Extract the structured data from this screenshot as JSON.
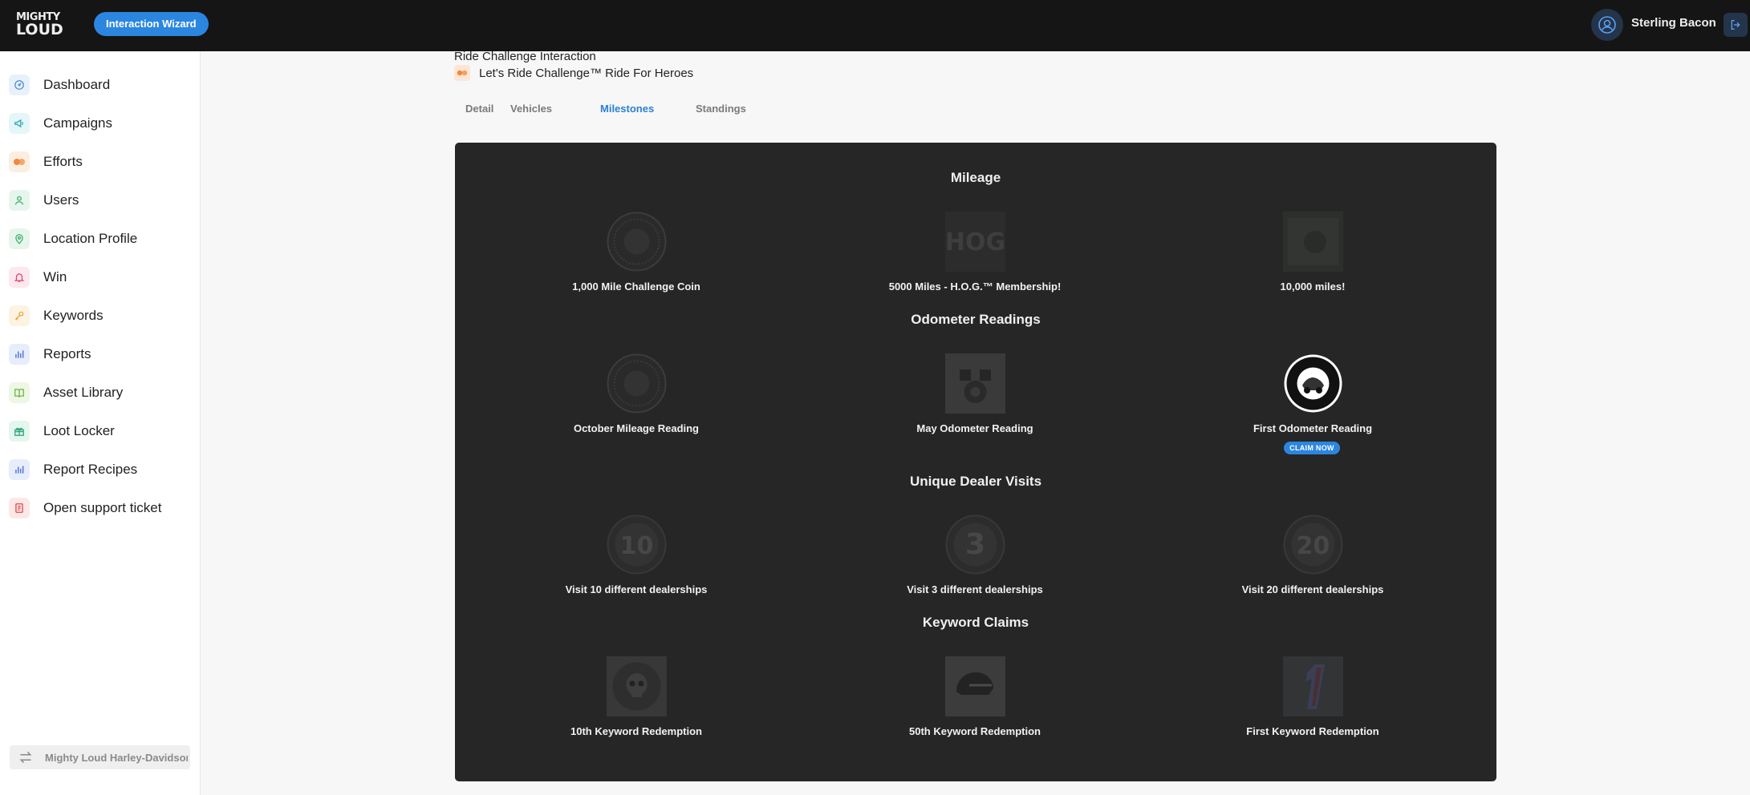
{
  "topbar": {
    "logo_line1": "MIGHTY",
    "logo_line2": "LOUD",
    "wizard_label": "Interaction Wizard",
    "user_name": "Sterling Bacon"
  },
  "sidebar": {
    "items": [
      {
        "label": "Dashboard",
        "icon": "dashboard-icon",
        "color": "#4a8fd8",
        "bg": "#e8f1fb"
      },
      {
        "label": "Campaigns",
        "icon": "megaphone-icon",
        "color": "#2aa6b8",
        "bg": "#e5f6f8"
      },
      {
        "label": "Efforts",
        "icon": "efforts-icon",
        "color": "#f08a3c",
        "bg": "#fdeee2"
      },
      {
        "label": "Users",
        "icon": "user-icon",
        "color": "#3fae6a",
        "bg": "#e7f6ed"
      },
      {
        "label": "Location Profile",
        "icon": "location-pin-icon",
        "color": "#3fae6a",
        "bg": "#e7f6ed"
      },
      {
        "label": "Win",
        "icon": "bell-icon",
        "color": "#e0456c",
        "bg": "#fce8ee"
      },
      {
        "label": "Keywords",
        "icon": "key-icon",
        "color": "#e8a23a",
        "bg": "#fdf3e2"
      },
      {
        "label": "Reports",
        "icon": "bar-chart-icon",
        "color": "#4a6fd8",
        "bg": "#e8edfb"
      },
      {
        "label": "Asset Library",
        "icon": "book-icon",
        "color": "#6bb53a",
        "bg": "#eef7e6"
      },
      {
        "label": "Loot Locker",
        "icon": "gift-icon",
        "color": "#2aa67a",
        "bg": "#e5f6ef"
      },
      {
        "label": "Report Recipes",
        "icon": "bar-chart-icon",
        "color": "#4a6fd8",
        "bg": "#e8edfb"
      },
      {
        "label": "Open support ticket",
        "icon": "ticket-icon",
        "color": "#e04545",
        "bg": "#fce8e8"
      }
    ],
    "account_label": "Mighty Loud Harley-Davidson"
  },
  "header": {
    "title": "Ride Challenge Interaction",
    "effort_name": "Let's Ride Challenge™ Ride For Heroes"
  },
  "tabs": [
    {
      "label": "Detail",
      "active": false
    },
    {
      "label": "Vehicles",
      "active": false
    },
    {
      "label": "Milestones",
      "active": true
    },
    {
      "label": "Standings",
      "active": false
    }
  ],
  "sections": [
    {
      "title": "Mileage",
      "badges": [
        {
          "label": "1,000 Mile Challenge Coin",
          "icon": "coin-icon"
        },
        {
          "label": "5000 Miles - H.O.G.™ Membership!",
          "icon": "hog-logo-icon"
        },
        {
          "label": "10,000 miles!",
          "icon": "photo-icon"
        }
      ]
    },
    {
      "title": "Odometer Readings",
      "badges": [
        {
          "label": "October Mileage Reading",
          "icon": "coin-icon"
        },
        {
          "label": "May Odometer Reading",
          "icon": "engine-icon"
        },
        {
          "label": "First Odometer Reading",
          "icon": "ride-challenge-seal-icon",
          "claim": "CLAIM NOW"
        }
      ]
    },
    {
      "title": "Unique Dealer Visits",
      "badges": [
        {
          "label": "Visit 10 different dealerships",
          "icon": "number-10-badge-icon",
          "number": "10"
        },
        {
          "label": "Visit 3 different dealerships",
          "icon": "number-3-badge-icon",
          "number": "3"
        },
        {
          "label": "Visit 20 different dealerships",
          "icon": "number-20-badge-icon",
          "number": "20"
        }
      ]
    },
    {
      "title": "Keyword Claims",
      "badges": [
        {
          "label": "10th Keyword Redemption",
          "icon": "skull-icon"
        },
        {
          "label": "50th Keyword Redemption",
          "icon": "helmet-icon"
        },
        {
          "label": "First Keyword Redemption",
          "icon": "number-one-icon"
        }
      ]
    }
  ]
}
